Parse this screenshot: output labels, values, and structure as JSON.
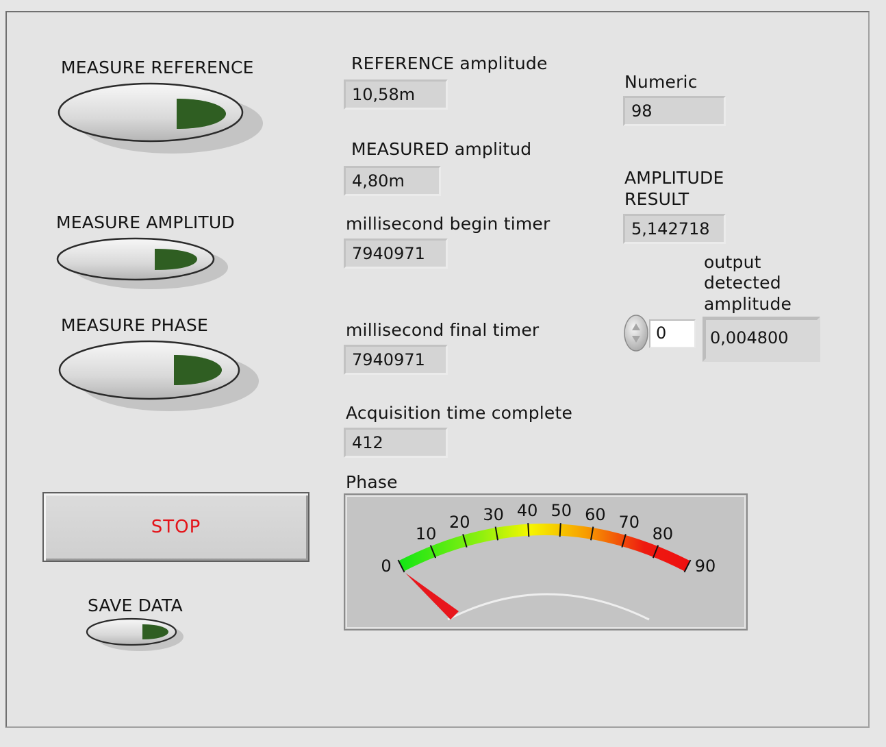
{
  "buttons": {
    "measure_reference": "MEASURE REFERENCE",
    "measure_amplitud": "MEASURE AMPLITUD",
    "measure_phase": "MEASURE PHASE",
    "stop": "STOP",
    "save_data": "SAVE DATA"
  },
  "indicators": {
    "reference_amplitude": {
      "label": "REFERENCE amplitude",
      "value": "10,58m"
    },
    "measured_amplitud": {
      "label": "MEASURED amplitud",
      "value": "4,80m"
    },
    "ms_begin_timer": {
      "label": "millisecond begin timer",
      "value": "7940971"
    },
    "ms_final_timer": {
      "label": "millisecond final timer",
      "value": "7940971"
    },
    "acq_time": {
      "label": "Acquisition time complete",
      "value": "412"
    },
    "numeric": {
      "label": "Numeric",
      "value": "98"
    },
    "amplitude_result": {
      "label_line1": "AMPLITUDE",
      "label_line2": "RESULT",
      "value": "5,142718"
    },
    "output_detected": {
      "label_line1": "output",
      "label_line2": "detected",
      "label_line3": "amplitude",
      "value": "0,004800"
    }
  },
  "index_control": {
    "value": "0"
  },
  "gauge": {
    "label": "Phase",
    "min": 0,
    "max": 90,
    "value": 0,
    "ticks": [
      "0",
      "10",
      "20",
      "30",
      "40",
      "50",
      "60",
      "70",
      "80",
      "90"
    ],
    "needle_color": "#e8161c"
  },
  "colors": {
    "led_on": "#2f5e22",
    "stop_text": "#e4141a",
    "panel": "#e4e4e4"
  }
}
